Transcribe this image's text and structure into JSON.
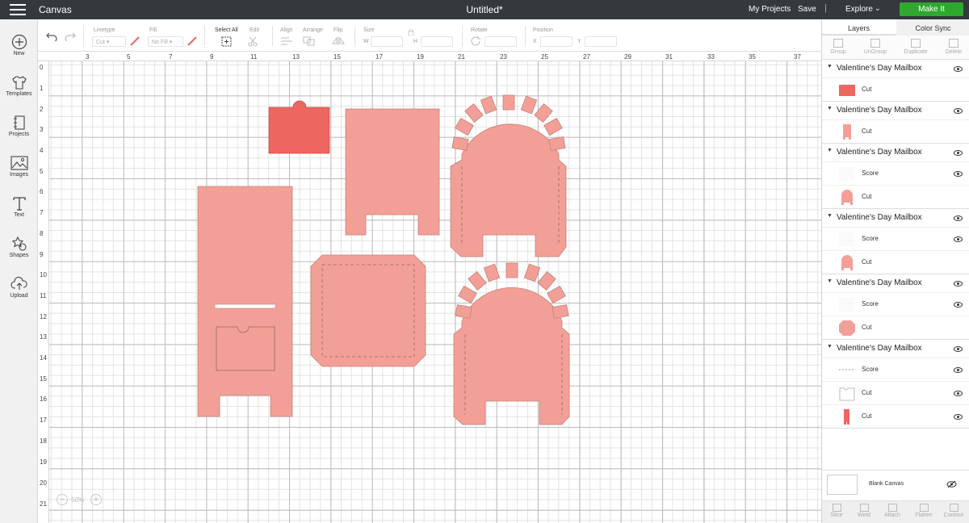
{
  "topbar": {
    "app_name": "Canvas",
    "doc_title": "Untitled*",
    "my_projects": "My Projects",
    "save": "Save",
    "separator": "|",
    "explore": "Explore",
    "make_it": "Make It"
  },
  "sidebar": {
    "items": [
      {
        "label": "New",
        "icon": "plus-icon"
      },
      {
        "label": "Templates",
        "icon": "tshirt-icon"
      },
      {
        "label": "Projects",
        "icon": "projects-icon"
      },
      {
        "label": "Images",
        "icon": "image-icon"
      },
      {
        "label": "Text",
        "icon": "text-icon"
      },
      {
        "label": "Shapes",
        "icon": "shapes-icon"
      },
      {
        "label": "Upload",
        "icon": "upload-icon"
      }
    ]
  },
  "toolbar": {
    "linetype_label": "Linetype",
    "linetype_value": "Cut",
    "fill_label": "Fill",
    "fill_value": "No Fill",
    "select_all": "Select All",
    "edit": "Edit",
    "align": "Align",
    "arrange": "Arrange",
    "flip": "Flip",
    "size": "Size",
    "w": "W",
    "h": "H",
    "rotate": "Rotate",
    "position": "Position",
    "x": "X",
    "y": "Y"
  },
  "rulers": {
    "top": [
      "3",
      "5",
      "7",
      "9",
      "11",
      "13",
      "15",
      "17",
      "19",
      "21",
      "23",
      "25",
      "27",
      "29",
      "31",
      "33",
      "35",
      "37"
    ],
    "left": [
      "0",
      "1",
      "2",
      "3",
      "4",
      "5",
      "6",
      "7",
      "8",
      "9",
      "10",
      "11",
      "12",
      "13",
      "14",
      "15",
      "16",
      "17",
      "18",
      "19",
      "20",
      "21"
    ]
  },
  "zoom": {
    "value": "50%",
    "minus": "−",
    "plus": "+"
  },
  "colors": {
    "salmon": "#f2a097",
    "red": "#ee6660",
    "accent_green": "#2fa82f",
    "topbar": "#34393d"
  },
  "panel": {
    "tabs": {
      "layers": "Layers",
      "color_sync": "Color Sync"
    },
    "actions": [
      "Group",
      "UnGroup",
      "Duplicate",
      "Delete"
    ],
    "groups": [
      {
        "name": "Valentine's Day Mailbox",
        "rows": [
          {
            "label": "Cut",
            "thumb": "red-rect"
          }
        ]
      },
      {
        "name": "Valentine's Day Mailbox",
        "rows": [
          {
            "label": "Cut",
            "thumb": "tall-panel"
          }
        ]
      },
      {
        "name": "Valentine's Day Mailbox",
        "rows": [
          {
            "label": "Score",
            "thumb": "blank"
          },
          {
            "label": "Cut",
            "thumb": "arch"
          }
        ]
      },
      {
        "name": "Valentine's Day Mailbox",
        "rows": [
          {
            "label": "Score",
            "thumb": "blank"
          },
          {
            "label": "Cut",
            "thumb": "arch"
          }
        ]
      },
      {
        "name": "Valentine's Day Mailbox",
        "rows": [
          {
            "label": "Score",
            "thumb": "blank"
          },
          {
            "label": "Cut",
            "thumb": "octagon"
          }
        ]
      },
      {
        "name": "Valentine's Day Mailbox",
        "rows": [
          {
            "label": "Score",
            "thumb": "dashes"
          },
          {
            "label": "Cut",
            "thumb": "outline"
          },
          {
            "label": "Cut",
            "thumb": "strip"
          }
        ]
      }
    ],
    "blank_canvas": "Blank Canvas",
    "bottom_actions": [
      "Slice",
      "Weld",
      "Attach",
      "Flatten",
      "Contour"
    ]
  }
}
